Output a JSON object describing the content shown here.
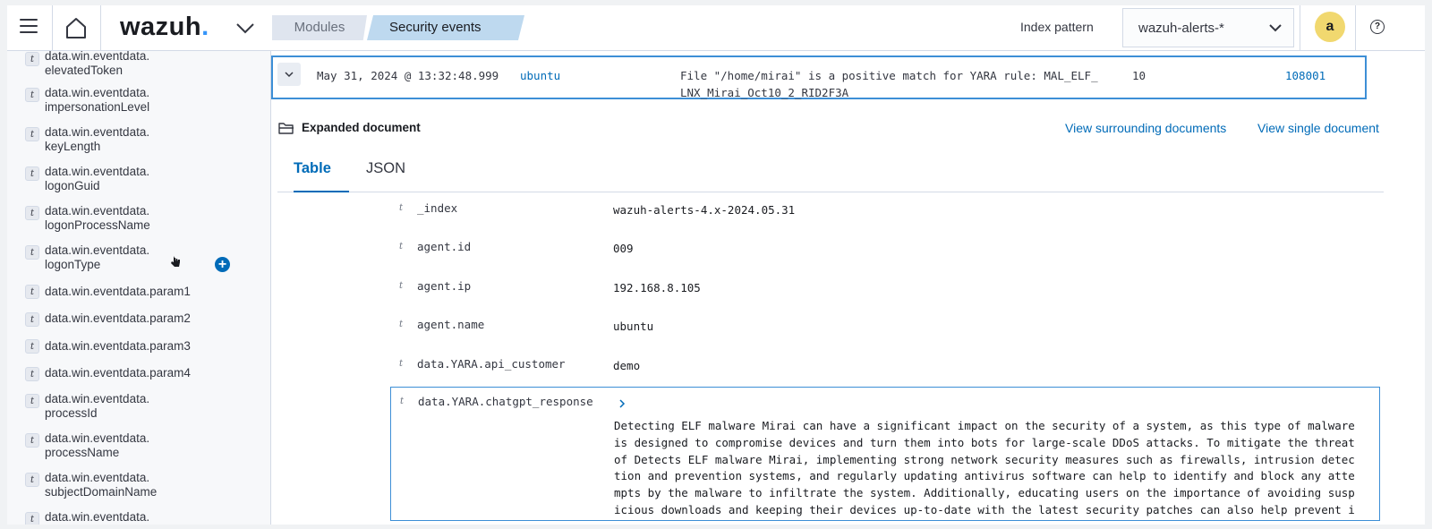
{
  "header": {
    "logo_main": "wazuh",
    "logo_dot": ".",
    "breadcrumb_modules": "Modules",
    "breadcrumb_current": "Security events",
    "index_pattern_label": "Index pattern",
    "index_pattern_value": "wazuh-alerts-*",
    "avatar_letter": "a",
    "help_symbol": "?"
  },
  "sidebar": {
    "type_badge": "t",
    "add_symbol": "+",
    "fields": [
      "data.win.eventdata.\nelevatedToken",
      "data.win.eventdata.\nimpersonationLevel",
      "data.win.eventdata.\nkeyLength",
      "data.win.eventdata.\nlogonGuid",
      "data.win.eventdata.\nlogonProcessName",
      "data.win.eventdata.\nlogonType",
      "data.win.eventdata.param1",
      "data.win.eventdata.param2",
      "data.win.eventdata.param3",
      "data.win.eventdata.param4",
      "data.win.eventdata.\nprocessId",
      "data.win.eventdata.\nprocessName",
      "data.win.eventdata.\nsubjectDomainName",
      "data.win.eventdata."
    ]
  },
  "document_row": {
    "timestamp": "May 31, 2024 @ 13:32:48.999",
    "agent": "ubuntu",
    "description": "File \"/home/mirai\" is a positive match for YARA rule: MAL_ELF_\nLNX_Mirai_Oct10_2_RID2F3A",
    "level": "10",
    "rule_id": "108001"
  },
  "expanded": {
    "title": "Expanded document",
    "view_surrounding": "View surrounding documents",
    "view_single": "View single document",
    "tabs": [
      "Table",
      "JSON"
    ],
    "type_badge": "t",
    "fields": [
      {
        "key": "_index",
        "value": "wazuh-alerts-4.x-2024.05.31"
      },
      {
        "key": "agent.id",
        "value": "009"
      },
      {
        "key": "agent.ip",
        "value": "192.168.8.105"
      },
      {
        "key": "agent.name",
        "value": "ubuntu"
      },
      {
        "key": "data.YARA.api_customer",
        "value": "demo"
      }
    ],
    "chatgpt_key": "data.YARA.chatgpt_response",
    "chatgpt_response": "Detecting ELF malware Mirai can have a significant impact on the security of a system, as this type of malware\nis designed to compromise devices and turn them into bots for large-scale DDoS attacks. To mitigate the threat\nof Detects ELF malware Mirai, implementing strong network security measures such as firewalls, intrusion detec\ntion and prevention systems, and regularly updating antivirus software can help to identify and block any atte\nmpts by the malware to infiltrate the system. Additionally, educating users on the importance of avoiding susp\nicious downloads and keeping their devices up-to-date with the latest security patches can also help prevent i"
  },
  "colors": {
    "link": "#006bb8",
    "highlight_border": "#3d8fd6",
    "breadcrumb_active": "#bed9ef",
    "avatar": "#f1d86f"
  }
}
